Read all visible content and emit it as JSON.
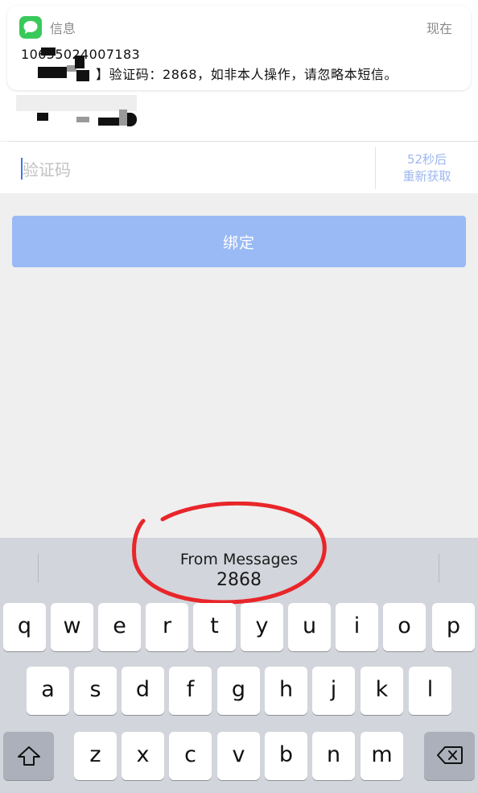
{
  "notification": {
    "app_name": "信息",
    "time": "现在",
    "sender": "10655024007183",
    "body": "】验证码：2868，如非本人操作，请忽略本短信。"
  },
  "form": {
    "code_placeholder": "验证码",
    "resend_countdown": "52秒后",
    "resend_action": "重新获取",
    "bind_button": "绑定"
  },
  "keyboard": {
    "suggestion_source": "From Messages",
    "suggestion_code": "2868",
    "rows": [
      [
        "q",
        "w",
        "e",
        "r",
        "t",
        "y",
        "u",
        "i",
        "o",
        "p"
      ],
      [
        "a",
        "s",
        "d",
        "f",
        "g",
        "h",
        "j",
        "k",
        "l"
      ],
      [
        "z",
        "x",
        "c",
        "v",
        "b",
        "n",
        "m"
      ]
    ]
  },
  "colors": {
    "primary_button": "#9abaf5",
    "link_text": "#9db7ef",
    "annotation_circle": "#e8262a",
    "messages_icon": "#39c95b"
  }
}
